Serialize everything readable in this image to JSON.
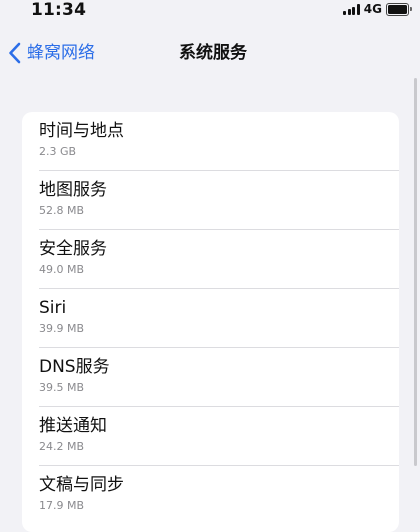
{
  "status_bar": {
    "time": "11:34",
    "network": "4G",
    "icons": [
      "signal-icon",
      "battery-icon"
    ]
  },
  "nav": {
    "back_label": "蜂窝网络",
    "title": "系统服务",
    "icons": [
      "chevron-left-icon"
    ]
  },
  "accent_color": "#2c6ee8",
  "services": {
    "items": [
      {
        "name": "时间与地点",
        "size": "2.3 GB"
      },
      {
        "name": "地图服务",
        "size": "52.8 MB"
      },
      {
        "name": "安全服务",
        "size": "49.0 MB"
      },
      {
        "name": "Siri",
        "size": "39.9 MB"
      },
      {
        "name": "DNS服务",
        "size": "39.5 MB"
      },
      {
        "name": "推送通知",
        "size": "24.2 MB"
      },
      {
        "name": "文稿与同步",
        "size": "17.9 MB"
      }
    ]
  }
}
